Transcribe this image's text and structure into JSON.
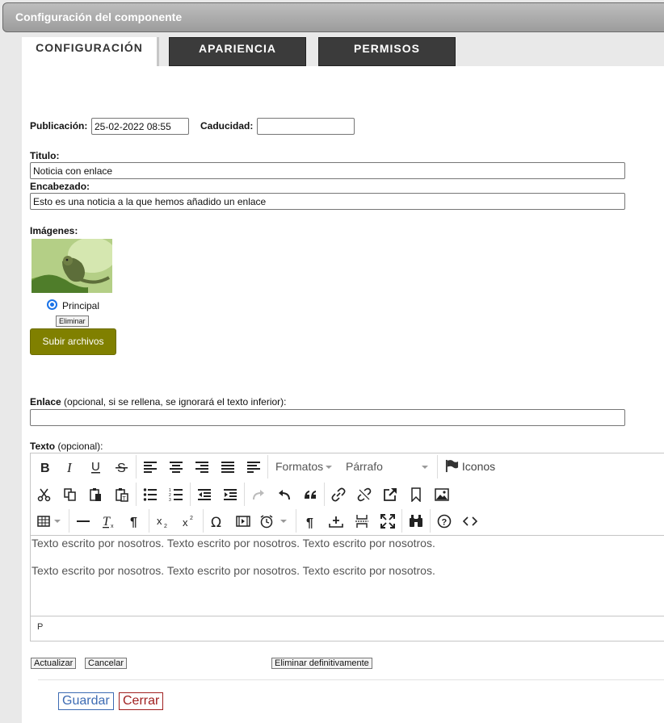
{
  "window": {
    "title": "Configuración del componente"
  },
  "tabs": [
    {
      "label": "CONFIGURACIÓN",
      "active": true
    },
    {
      "label": "APARIENCIA",
      "active": false
    },
    {
      "label": "PERMISOS",
      "active": false
    }
  ],
  "form": {
    "publicacion_label": "Publicación:",
    "publicacion_value": "25-02-2022 08:55",
    "caducidad_label": "Caducidad:",
    "caducidad_value": "",
    "titulo_label": "Titulo:",
    "titulo_value": "Noticia con enlace",
    "encabezado_label": "Encabezado:",
    "encabezado_value": "Esto es una noticia a la que hemos añadido un enlace",
    "imagenes_label": "Imágenes:",
    "image_radio_label": "Principal",
    "image_delete_label": "Eliminar",
    "upload_label": "Subir archivos",
    "enlace_label": "Enlace",
    "enlace_hint": " (opcional, si se rellena, se ignorará el texto inferior):",
    "enlace_value": "",
    "texto_label": "Texto",
    "texto_hint": " (opcional):"
  },
  "editor": {
    "formats_label": "Formatos",
    "block_label": "Párrafo",
    "icons_label": "Iconos",
    "content": [
      "Texto escrito por nosotros. Texto escrito por nosotros. Texto escrito por nosotros.",
      "Texto escrito por nosotros. Texto escrito por nosotros. Texto escrito por nosotros."
    ],
    "path": "P",
    "toolbar_icons": [
      "bold-icon",
      "italic-icon",
      "underline-icon",
      "strikethrough-icon",
      "align-left-icon",
      "align-center-icon",
      "align-right-icon",
      "align-justify-icon",
      "align-none-icon",
      "flag-icon",
      "cut-icon",
      "copy-icon",
      "paste-icon",
      "paste-text-icon",
      "bullet-list-icon",
      "numbered-list-icon",
      "outdent-icon",
      "indent-icon",
      "redo-icon",
      "undo-icon",
      "blockquote-icon",
      "link-icon",
      "unlink-icon",
      "external-link-icon",
      "bookmark-icon",
      "image-icon",
      "table-icon",
      "horizontal-rule-icon",
      "clear-format-icon",
      "pilcrow-icon",
      "subscript-icon",
      "superscript-icon",
      "omega-icon",
      "media-icon",
      "clock-icon",
      "paragraph-icon",
      "insert-below-icon",
      "page-break-icon",
      "fullscreen-icon",
      "find-icon",
      "help-icon",
      "code-icon"
    ]
  },
  "actions": {
    "actualizar": "Actualizar",
    "cancelar": "Cancelar",
    "eliminar_def": "Eliminar definitivamente",
    "guardar": "Guardar",
    "cerrar": "Cerrar"
  },
  "colors": {
    "upload_bg": "#808000",
    "guardar": "#3d6bb3",
    "cerrar": "#a02020",
    "radio": "#1a73e8"
  }
}
